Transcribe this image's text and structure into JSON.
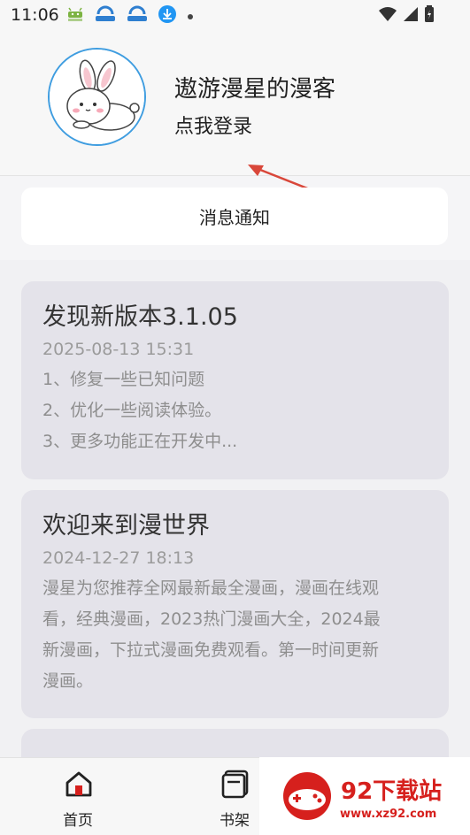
{
  "status_bar": {
    "time": "11:06",
    "icons_left": [
      "android-icon",
      "cloud-sync-icon",
      "cloud-sync-icon",
      "download-icon",
      "dot-icon"
    ],
    "icons_right": [
      "wifi-icon",
      "signal-icon",
      "battery-icon"
    ]
  },
  "profile": {
    "username": "遨游漫星的漫客",
    "login_link": "点我登录"
  },
  "notice_button": {
    "label": "消息通知"
  },
  "notices": [
    {
      "title": "发现新版本3.1.05",
      "date": "2025-08-13 15:31",
      "lines": [
        "1、修复一些已知问题",
        "2、优化一些阅读体验。",
        "3、更多功能正在开发中..."
      ]
    },
    {
      "title": "欢迎来到漫世界",
      "date": "2024-12-27 18:13",
      "lines": [
        "漫星为您推荐全网最新最全漫画，漫画在线观",
        "看，经典漫画，2023热门漫画大全，2024最",
        "新漫画，下拉式漫画免费观看。第一时间更新",
        "漫画。"
      ]
    }
  ],
  "bottom_nav": [
    {
      "label": "首页",
      "icon": "home-icon"
    },
    {
      "label": "书架",
      "icon": "bookshelf-icon"
    }
  ],
  "watermark": {
    "title": "92下载站",
    "url": "www.xz92.com"
  },
  "colors": {
    "accent": "#3f9de0",
    "arrow": "#d9473a",
    "card": "#e4e3ea",
    "watermark": "#d6201d"
  }
}
